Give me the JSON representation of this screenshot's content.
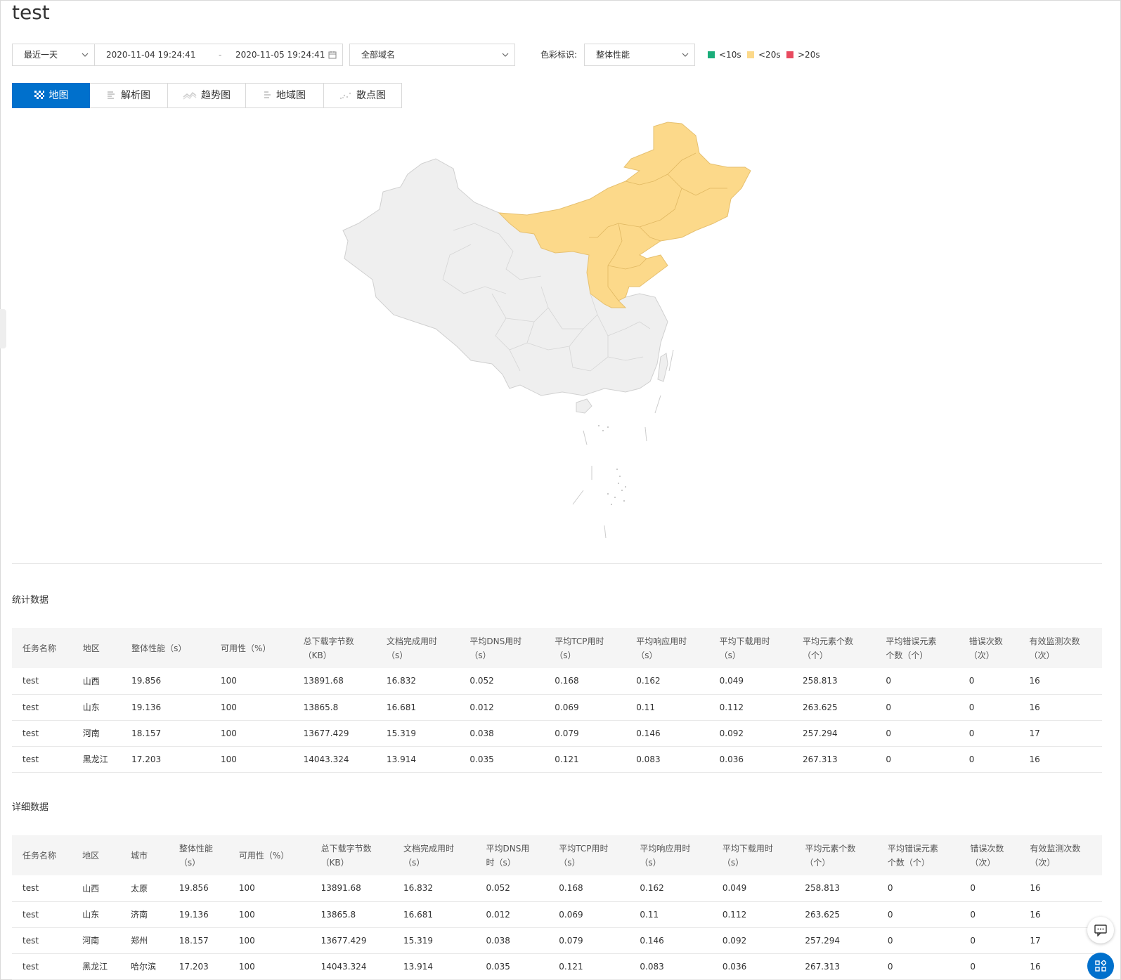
{
  "page": {
    "title": "test"
  },
  "filters": {
    "range": "最近一天",
    "start": "2020-11-04 19:24:41",
    "sep": "-",
    "end": "2020-11-05 19:24:41",
    "domain": "全部域名",
    "color_label": "色彩标识:",
    "color_mode": "整体性能",
    "legend": [
      {
        "label": "<10s",
        "color": "#1aad7a"
      },
      {
        "label": "<20s",
        "color": "#fcd98a"
      },
      {
        "label": ">20s",
        "color": "#e84a5f"
      }
    ]
  },
  "tabs": [
    {
      "label": "地图",
      "icon": "map-icon",
      "active": true
    },
    {
      "label": "解析图",
      "icon": "bar-icon",
      "active": false
    },
    {
      "label": "趋势图",
      "icon": "trend-icon",
      "active": false
    },
    {
      "label": "地域图",
      "icon": "region-icon",
      "active": false
    },
    {
      "label": "散点图",
      "icon": "scatter-icon",
      "active": false
    }
  ],
  "map": {
    "highlight_color": "#fcd98a",
    "base_color": "#efefef",
    "highlighted_regions": [
      "山西",
      "山东",
      "河南",
      "黑龙江"
    ]
  },
  "stats": {
    "title": "统计数据",
    "headers": [
      [
        "任务名称",
        ""
      ],
      [
        "地区",
        ""
      ],
      [
        "整体性能（s）",
        ""
      ],
      [
        "可用性（%）",
        ""
      ],
      [
        "总下载字节数",
        "（KB）"
      ],
      [
        "文档完成用时",
        "（s）"
      ],
      [
        "平均DNS用时",
        "（s）"
      ],
      [
        "平均TCP用时",
        "（s）"
      ],
      [
        "平均响应用时",
        "（s）"
      ],
      [
        "平均下载用时",
        "（s）"
      ],
      [
        "平均元素个数",
        "（个）"
      ],
      [
        "平均错误元素",
        "个数（个）"
      ],
      [
        "错误次数",
        "（次）"
      ],
      [
        "有效监测次数",
        "（次）"
      ]
    ],
    "rows": [
      [
        "test",
        "山西",
        "19.856",
        "100",
        "13891.68",
        "16.832",
        "0.052",
        "0.168",
        "0.162",
        "0.049",
        "258.813",
        "0",
        "0",
        "16"
      ],
      [
        "test",
        "山东",
        "19.136",
        "100",
        "13865.8",
        "16.681",
        "0.012",
        "0.069",
        "0.11",
        "0.112",
        "263.625",
        "0",
        "0",
        "16"
      ],
      [
        "test",
        "河南",
        "18.157",
        "100",
        "13677.429",
        "15.319",
        "0.038",
        "0.079",
        "0.146",
        "0.092",
        "257.294",
        "0",
        "0",
        "17"
      ],
      [
        "test",
        "黑龙江",
        "17.203",
        "100",
        "14043.324",
        "13.914",
        "0.035",
        "0.121",
        "0.083",
        "0.036",
        "267.313",
        "0",
        "0",
        "16"
      ]
    ]
  },
  "details": {
    "title": "详细数据",
    "headers": [
      [
        "任务名称",
        ""
      ],
      [
        "地区",
        ""
      ],
      [
        "城市",
        ""
      ],
      [
        "整体性能",
        "（s）"
      ],
      [
        "可用性（%）",
        ""
      ],
      [
        "总下载字节数",
        "（KB）"
      ],
      [
        "文档完成用时",
        "（s）"
      ],
      [
        "平均DNS用",
        "时（s）"
      ],
      [
        "平均TCP用时",
        "（s）"
      ],
      [
        "平均响应用时",
        "（s）"
      ],
      [
        "平均下载用时",
        "（s）"
      ],
      [
        "平均元素个数",
        "（个）"
      ],
      [
        "平均错误元素",
        "个数（个）"
      ],
      [
        "错误次数",
        "（次）"
      ],
      [
        "有效监测次数",
        "（次）"
      ]
    ],
    "rows": [
      [
        "test",
        "山西",
        "太原",
        "19.856",
        "100",
        "13891.68",
        "16.832",
        "0.052",
        "0.168",
        "0.162",
        "0.049",
        "258.813",
        "0",
        "0",
        "16"
      ],
      [
        "test",
        "山东",
        "济南",
        "19.136",
        "100",
        "13865.8",
        "16.681",
        "0.012",
        "0.069",
        "0.11",
        "0.112",
        "263.625",
        "0",
        "0",
        "16"
      ],
      [
        "test",
        "河南",
        "郑州",
        "18.157",
        "100",
        "13677.429",
        "15.319",
        "0.038",
        "0.079",
        "0.146",
        "0.092",
        "257.294",
        "0",
        "0",
        "17"
      ],
      [
        "test",
        "黑龙江",
        "哈尔滨",
        "17.203",
        "100",
        "14043.324",
        "13.914",
        "0.035",
        "0.121",
        "0.083",
        "0.036",
        "267.313",
        "0",
        "0",
        "16"
      ]
    ]
  }
}
